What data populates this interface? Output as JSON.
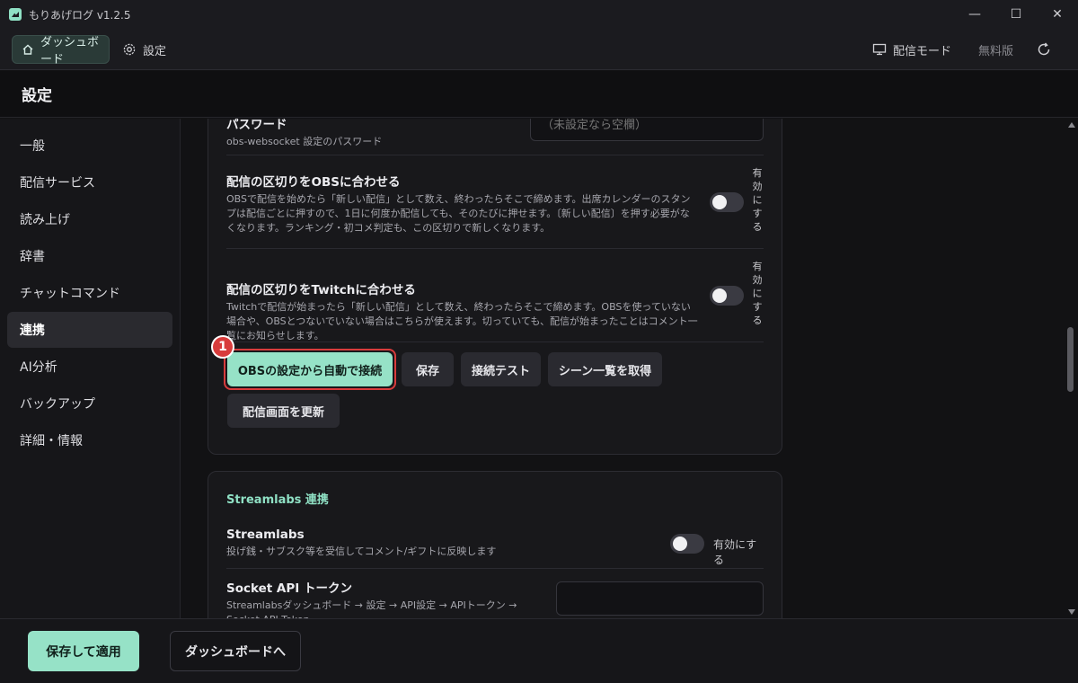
{
  "window": {
    "title": "もりあげログ  v1.2.5",
    "minimize": "—",
    "maximize": "☐",
    "close": "✕"
  },
  "topnav": {
    "dashboard": "ダッシュボード",
    "settings": "設定",
    "broadcast_mode": "配信モード",
    "free_version": "無料版"
  },
  "page": {
    "title": "設定"
  },
  "sidebar": {
    "items": [
      {
        "label": "一般"
      },
      {
        "label": "配信サービス"
      },
      {
        "label": "読み上げ"
      },
      {
        "label": "辞書"
      },
      {
        "label": "チャットコマンド"
      },
      {
        "label": "連携"
      },
      {
        "label": "AI分析"
      },
      {
        "label": "バックアップ"
      },
      {
        "label": "詳細・情報"
      }
    ]
  },
  "obs": {
    "password": {
      "title": "パスワード",
      "desc": "obs-websocket 設定のパスワード",
      "placeholder": "（未設定なら空欄）"
    },
    "split_obs": {
      "title": "配信の区切りをOBSに合わせる",
      "desc": "OBSで配信を始めたら「新しい配信」として数え、終わったらそこで締めます。出席カレンダーのスタンプは配信ごとに押すので、1日に何度か配信しても、そのたびに押せます。〔新しい配信〕を押す必要がなくなります。ランキング・初コメ判定も、この区切りで新しくなります。",
      "toggle_label": "有効にする"
    },
    "split_twitch": {
      "title": "配信の区切りをTwitchに合わせる",
      "desc": "Twitchで配信が始まったら「新しい配信」として数え、終わったらそこで締めます。OBSを使っていない場合や、OBSとつないでいない場合はこちらが使えます。切っていても、配信が始まったことはコメント一覧にお知らせします。",
      "toggle_label": "有効にする"
    },
    "buttons": {
      "auto_connect": "OBSの設定から自動で接続",
      "save": "保存",
      "test": "接続テスト",
      "scenes": "シーン一覧を取得",
      "refresh_screen": "配信画面を更新"
    },
    "badge": "1"
  },
  "streamlabs": {
    "section_title": "Streamlabs 連携",
    "toggle": {
      "title": "Streamlabs",
      "desc": "投げ銭・サブスク等を受信してコメント/ギフトに反映します",
      "label": "有効にする"
    },
    "token": {
      "title": "Socket API トークン",
      "desc": "Streamlabsダッシュボード → 設定 → API設定 → APIトークン → Socket API Token"
    }
  },
  "footer": {
    "save_apply": "保存して適用",
    "to_dashboard": "ダッシュボードへ"
  },
  "colors": {
    "accent": "#96e2c7",
    "highlight": "#d83c3c"
  }
}
